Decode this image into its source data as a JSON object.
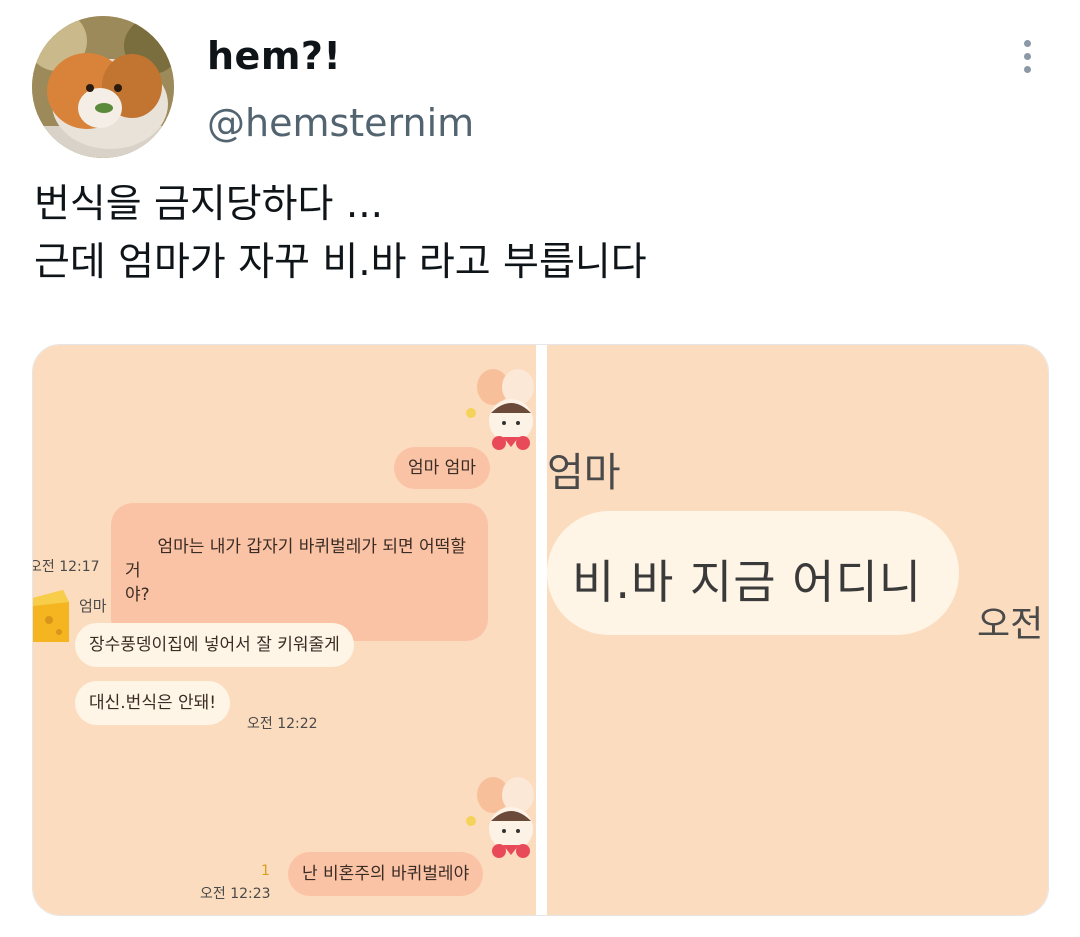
{
  "tweet": {
    "display_name": "hem?!",
    "handle": "@hemsternim",
    "text_lines": [
      "번식을 금지당하다 ...",
      "근데 엄마가 자꾸 비.바 라고 부릅니다"
    ]
  },
  "media": {
    "left_image": {
      "messages": [
        {
          "side": "me",
          "text": "엄마 엄마"
        },
        {
          "side": "me",
          "text": "엄마는 내가 갑자기 바퀴벌레가 되면 어떡할거\n야?",
          "time": "오전 12:17"
        },
        {
          "side": "other",
          "sender": "엄마",
          "text": "장수풍뎅이집에 넣어서 잘 키워줄게"
        },
        {
          "side": "other",
          "text": "대신.번식은 안돼!",
          "time": "오전 12:22"
        },
        {
          "side": "me",
          "text": "난 비혼주의 바퀴벌레야",
          "time": "오전 12:23",
          "unread": "1"
        }
      ]
    },
    "right_image": {
      "sender": "엄마",
      "text": "비.바 지금 어디니",
      "time": "오전"
    }
  },
  "colors": {
    "chat_background": "#fcdcbf",
    "my_bubble": "#fbc3a5",
    "other_bubble": "#fff5e6",
    "handle_gray": "#536471"
  },
  "icons": [
    "more-options-icon",
    "guinea-pig-avatar",
    "character-sticker-icon",
    "cheese-profile-icon"
  ]
}
